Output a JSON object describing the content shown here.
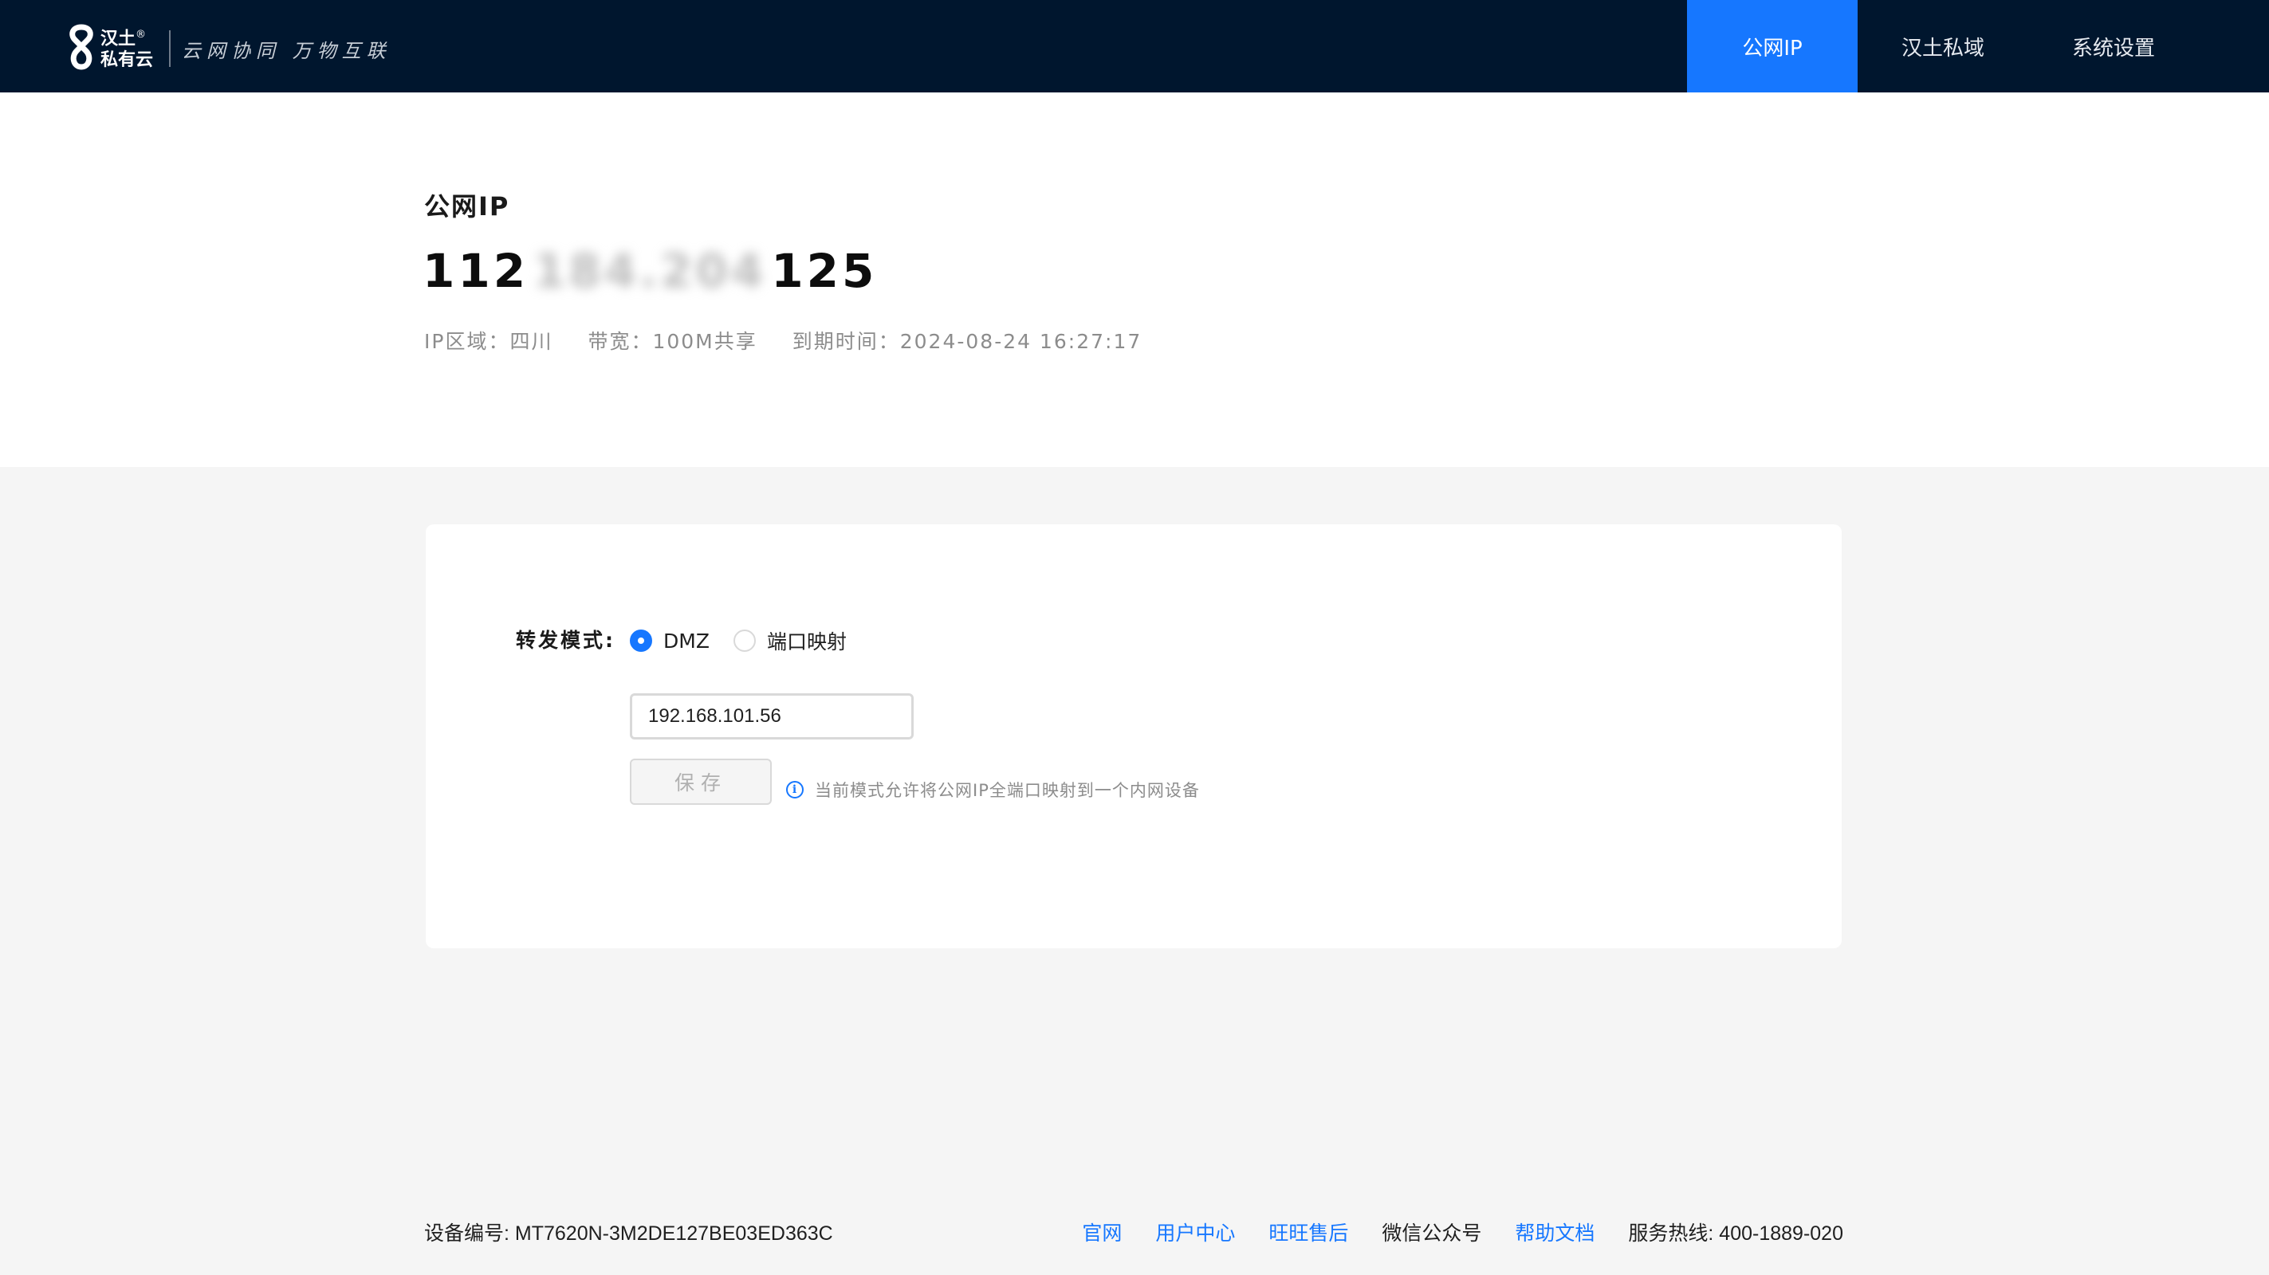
{
  "header": {
    "brand_line1": "汉土",
    "brand_reg": "®",
    "brand_line2": "私有云",
    "slogan": "云网协同  万物互联",
    "nav": [
      {
        "label": "公网IP",
        "active": true
      },
      {
        "label": "汉土私域",
        "active": false
      },
      {
        "label": "系统设置",
        "active": false
      }
    ]
  },
  "ip": {
    "title": "公网IP",
    "prefix": "112",
    "masked": "184.204",
    "suffix": "125",
    "region": "IP区域：四川",
    "bandwidth": "带宽：100M共享",
    "expiry": "到期时间：2024-08-24 16:27:17"
  },
  "forward": {
    "label": "转发模式:",
    "options": [
      {
        "label": "DMZ",
        "selected": true
      },
      {
        "label": "端口映射",
        "selected": false
      }
    ],
    "ip_value": "192.168.101.56",
    "save_label": "保存",
    "hint": "当前模式允许将公网IP全端口映射到一个内网设备"
  },
  "footer": {
    "device": "设备编号: MT7620N-3M2DE127BE03ED363C",
    "links": [
      "官网",
      "用户中心",
      "旺旺售后"
    ],
    "wechat": "微信公众号",
    "docs": "帮助文档",
    "hotline": "服务热线: 400-1889-020"
  },
  "colors": {
    "nav_bg": "#00162e",
    "accent": "#1677ff",
    "page_bg": "#f5f5f5"
  },
  "icons": {
    "logo": "hantu-logo-icon",
    "hint": "info-icon",
    "radio_checked": "radio-checked-icon",
    "radio_unchecked": "radio-unchecked-icon"
  }
}
